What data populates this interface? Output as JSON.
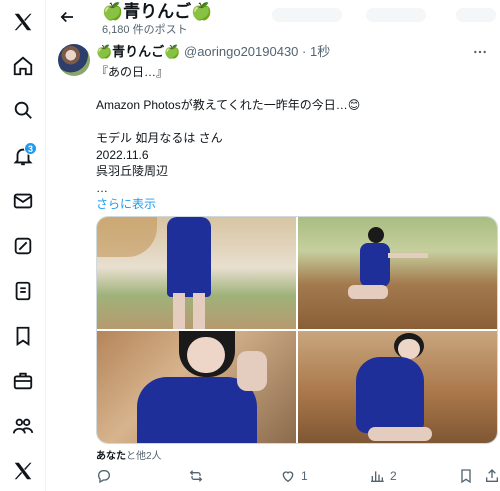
{
  "nav": {
    "notifications_badge": "3"
  },
  "header": {
    "title": "🍏青りんご🍏",
    "post_count": "6,180 件のポスト"
  },
  "post": {
    "display_name": "🍏青りんご🍏",
    "handle": "@aoringo20190430",
    "separator": " · ",
    "time": "1秒",
    "lines": [
      "『あの日…』",
      "",
      "Amazon Photosが教えてくれた一昨年の今日…😊",
      "",
      "モデル 如月なるは さん",
      "2022.11.6",
      "呉羽丘陵周辺",
      "…"
    ],
    "show_more": "さらに表示",
    "liked_by_name": "あなた",
    "liked_by_rest": "と他2人",
    "reply_count": "",
    "repost_count": "",
    "like_count": "1",
    "views_count": "2"
  },
  "colors": {
    "accent": "#1d9bf0",
    "text": "#0f1419",
    "muted": "#536471",
    "dress": "#1f2f9a"
  }
}
